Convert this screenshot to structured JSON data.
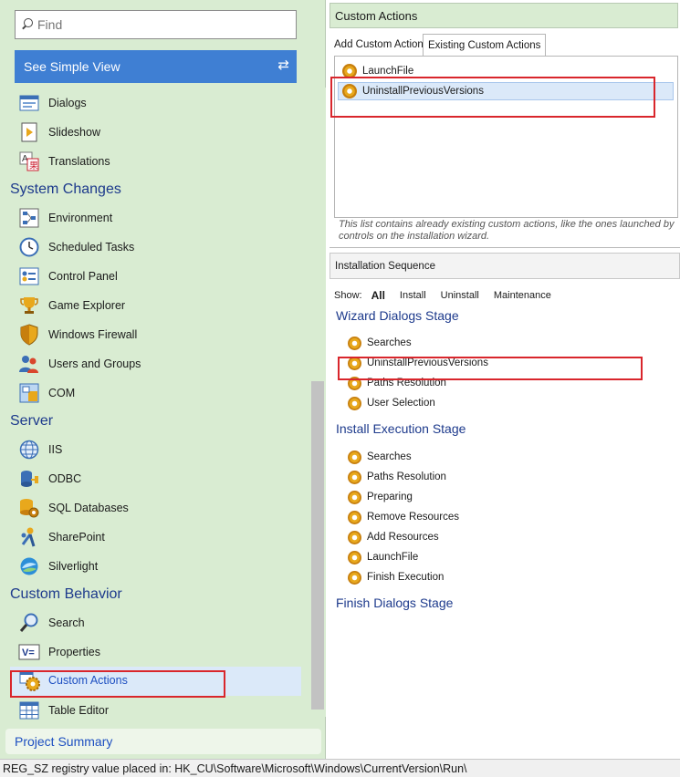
{
  "search": {
    "placeholder": "Find"
  },
  "simple_view": {
    "label": "See Simple View"
  },
  "tree": {
    "items_top": [
      {
        "label": "Dialogs",
        "icon": "dialogs-icon"
      },
      {
        "label": "Slideshow",
        "icon": "slideshow-icon"
      },
      {
        "label": "Translations",
        "icon": "translations-icon"
      }
    ],
    "system_changes": {
      "title": "System Changes",
      "items": [
        {
          "label": "Environment",
          "icon": "environment-icon"
        },
        {
          "label": "Scheduled Tasks",
          "icon": "clock-icon"
        },
        {
          "label": "Control Panel",
          "icon": "control-panel-icon"
        },
        {
          "label": "Game Explorer",
          "icon": "trophy-icon"
        },
        {
          "label": "Windows Firewall",
          "icon": "shield-icon"
        },
        {
          "label": "Users and Groups",
          "icon": "users-icon"
        },
        {
          "label": "COM",
          "icon": "com-icon"
        }
      ]
    },
    "server": {
      "title": "Server",
      "items": [
        {
          "label": "IIS",
          "icon": "globe-icon"
        },
        {
          "label": "ODBC",
          "icon": "plug-icon"
        },
        {
          "label": "SQL Databases",
          "icon": "database-icon"
        },
        {
          "label": "SharePoint",
          "icon": "sharepoint-icon"
        },
        {
          "label": "Silverlight",
          "icon": "silverlight-icon"
        }
      ]
    },
    "custom_behavior": {
      "title": "Custom Behavior",
      "items": [
        {
          "label": "Search",
          "icon": "search-icon"
        },
        {
          "label": "Properties",
          "icon": "properties-icon"
        },
        {
          "label": "Custom Actions",
          "icon": "gear-icon"
        },
        {
          "label": "Table Editor",
          "icon": "table-icon"
        }
      ]
    }
  },
  "project_summary": {
    "label": "Project Summary"
  },
  "custom_actions": {
    "header": "Custom Actions",
    "tabs": [
      {
        "label": "Add Custom Action"
      },
      {
        "label": "Existing Custom Actions"
      }
    ],
    "list": [
      "LaunchFile",
      "UninstallPreviousVersions"
    ],
    "note": "This list contains already existing custom actions, like the ones launched by controls on the installation wizard."
  },
  "installation_sequence": {
    "header": "Installation Sequence",
    "show_label": "Show:",
    "filters": [
      "All",
      "Install",
      "Uninstall",
      "Maintenance"
    ],
    "stages": [
      {
        "title": "Wizard Dialogs Stage",
        "items": [
          "Searches",
          "UninstallPreviousVersions",
          "Paths Resolution",
          "User Selection"
        ]
      },
      {
        "title": "Install Execution Stage",
        "items": [
          "Searches",
          "Paths Resolution",
          "Preparing",
          "Remove Resources",
          "Add Resources",
          "LaunchFile",
          "Finish Execution"
        ]
      },
      {
        "title": "Finish Dialogs Stage",
        "items": []
      }
    ]
  },
  "status": {
    "text": "REG_SZ registry value placed in: HK_CU\\Software\\Microsoft\\Windows\\CurrentVersion\\Run\\"
  },
  "colors": {
    "panel_green": "#d9ecd2",
    "accent_blue": "#3f7fd3",
    "section_blue": "#1d3a8c",
    "highlight_red": "#d9262c"
  }
}
